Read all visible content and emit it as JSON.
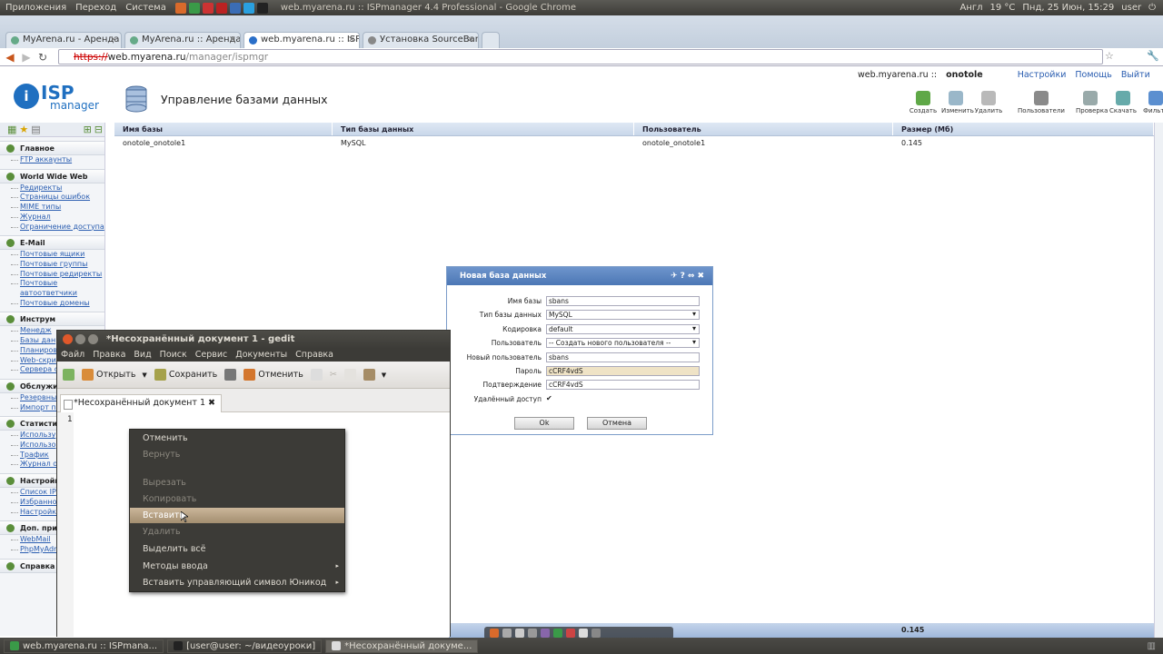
{
  "top_panel": {
    "menu": [
      "Приложения",
      "Переход",
      "Система"
    ],
    "window_title": "web.myarena.ru :: ISPmanager 4.4 Professional - Google Chrome",
    "tray": {
      "layout": "Англ",
      "weather": "19 °C",
      "datetime": "Пнд, 25 Июн, 15:29",
      "user": "user"
    }
  },
  "browser": {
    "tabs": [
      {
        "label": "MyArena.ru - Аренда и",
        "active": false
      },
      {
        "label": "MyArena.ru :: Аренда и",
        "active": false
      },
      {
        "label": "web.myarena.ru :: ISPm",
        "active": true
      },
      {
        "label": "Установка SourceBans",
        "active": false
      }
    ],
    "url": {
      "scheme": "https://",
      "host": "web.myarena.ru",
      "path": "/manager/ispmgr"
    }
  },
  "isp": {
    "logo_isp": "ISP",
    "logo_manager": "manager",
    "page_title": "Управление базами данных",
    "header": {
      "site": "web.myarena.ru ::",
      "user": "onotole",
      "settings": "Настройки",
      "help": "Помощь",
      "logout": "Выйти"
    },
    "toolbar": [
      "Создать",
      "Изменить",
      "Удалить",
      "Пользователи",
      "Проверка",
      "Скачать",
      "Фильтр"
    ]
  },
  "sidebar": {
    "groups": [
      {
        "title": "Главное",
        "items": [
          "FTP аккаунты"
        ]
      },
      {
        "title": "World Wide Web",
        "items": [
          "Редиректы",
          "Страницы ошибок",
          "MIME типы",
          "Журнал",
          "Ограничение доступа"
        ]
      },
      {
        "title": "E-Mail",
        "items": [
          "Почтовые ящики",
          "Почтовые группы",
          "Почтовые редиректы",
          "Почтовые автоответчики",
          "Почтовые домены"
        ]
      },
      {
        "title": "Инструм",
        "items": [
          "Менедж",
          "Базы дан",
          "Планиров",
          "Web-скри",
          "Сервера с"
        ]
      },
      {
        "title": "Обслужи",
        "items": [
          "Резервны",
          "Импорт по"
        ]
      },
      {
        "title": "Статисти",
        "items": [
          "Использу",
          "Использо",
          "Трафик",
          "Журнал о"
        ]
      },
      {
        "title": "Настройк",
        "items": [
          "Список IP",
          "Избранно",
          "Настройк"
        ]
      },
      {
        "title": "Доп. при",
        "items": [
          "WebMail",
          "PhpMyAdm"
        ]
      },
      {
        "title": "Справка",
        "items": []
      }
    ]
  },
  "table": {
    "columns": [
      "Имя базы",
      "Тип базы данных",
      "Пользователь",
      "Размер (Мб)"
    ],
    "rows": [
      [
        "onotole_onotole1",
        "MySQL",
        "onotole_onotole1",
        "0.145"
      ]
    ],
    "total": "0.145"
  },
  "dialog": {
    "title": "Новая база данных",
    "fields": [
      {
        "label": "Имя базы",
        "value": "sbans"
      },
      {
        "label": "Тип базы данных",
        "value": "MySQL"
      },
      {
        "label": "Кодировка",
        "value": "default"
      },
      {
        "label": "Пользователь",
        "value": "-- Создать нового пользователя --"
      },
      {
        "label": "Новый пользователь",
        "value": "sbans"
      },
      {
        "label": "Пароль",
        "value": "cCRF4vdS"
      },
      {
        "label": "Подтверждение",
        "value": "cCRF4vdS"
      },
      {
        "label": "Удалённый доступ",
        "value": "✔"
      }
    ],
    "ok": "Ok",
    "cancel": "Отмена"
  },
  "gedit": {
    "title": "*Несохранённый документ 1 - gedit",
    "menu": [
      "Файл",
      "Правка",
      "Вид",
      "Поиск",
      "Сервис",
      "Документы",
      "Справка"
    ],
    "toolbar": {
      "open": "Открыть",
      "save": "Сохранить",
      "undo": "Отменить"
    },
    "tab": "*Несохранённый документ 1",
    "line_number": "1"
  },
  "context_menu": {
    "items": [
      {
        "label": "Отменить",
        "state": "normal"
      },
      {
        "label": "Вернуть",
        "state": "disabled"
      },
      {
        "label": "Вырезать",
        "state": "disabled"
      },
      {
        "label": "Копировать",
        "state": "disabled"
      },
      {
        "label": "Вставить",
        "state": "highlighted"
      },
      {
        "label": "Удалить",
        "state": "disabled"
      },
      {
        "label": "Выделить всё",
        "state": "normal"
      },
      {
        "label": "Методы ввода",
        "state": "submenu"
      },
      {
        "label": "Вставить управляющий символ Юникод",
        "state": "submenu"
      }
    ]
  },
  "taskbar": [
    {
      "label": "web.myarena.ru :: ISPmana...",
      "active": false
    },
    {
      "label": "[user@user: ~/видеоуроки]",
      "active": false
    },
    {
      "label": "*Несохранённый докуме...",
      "active": true
    }
  ],
  "colors": {
    "isp_blue": "#1f6fc0",
    "dialog_header": "#4c77b5",
    "menu_dark": "#3c3b37",
    "highlight": "#a38e70"
  }
}
